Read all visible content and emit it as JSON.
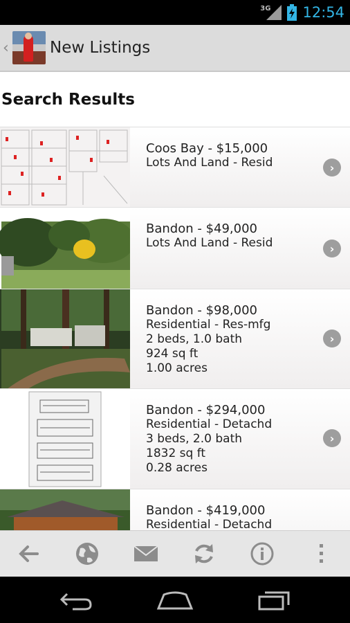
{
  "status_bar": {
    "network": "3G",
    "time": "12:54"
  },
  "action_bar": {
    "title": "New Listings"
  },
  "section": {
    "title": "Search Results"
  },
  "listings": [
    {
      "heading": "Coos Bay - $15,000",
      "type": "Lots And Land - Resid",
      "beds": "",
      "sqft": "",
      "acres": ""
    },
    {
      "heading": "Bandon - $49,000",
      "type": "Lots And Land - Resid",
      "beds": "",
      "sqft": "",
      "acres": ""
    },
    {
      "heading": "Bandon - $98,000",
      "type": "Residential - Res-mfg",
      "beds": "2 beds, 1.0 bath",
      "sqft": "924 sq ft",
      "acres": "1.00 acres"
    },
    {
      "heading": "Bandon - $294,000",
      "type": "Residential - Detachd",
      "beds": "3 beds, 2.0 bath",
      "sqft": "1832 sq ft",
      "acres": "0.28 acres"
    },
    {
      "heading": "Bandon - $419,000",
      "type": "Residential - Detachd",
      "beds": "",
      "sqft": "",
      "acres": ""
    }
  ],
  "toolbar": [
    "back-arrow-icon",
    "globe-icon",
    "mail-icon",
    "refresh-icon",
    "info-icon",
    "overflow-menu-icon"
  ],
  "colors": {
    "accent": "#33b5e5",
    "action_bar": "#dcdcdc",
    "toolbar": "#e6e6e6"
  }
}
